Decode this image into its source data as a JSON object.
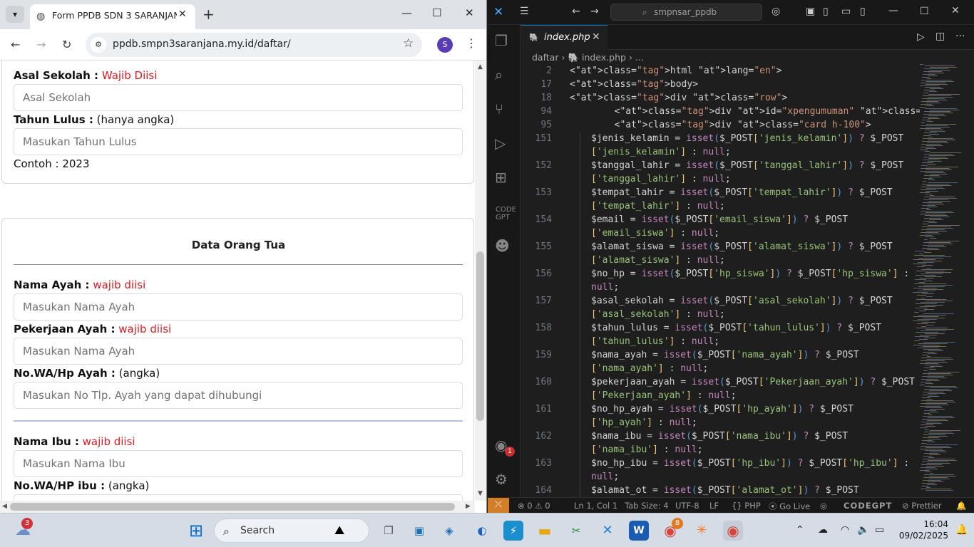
{
  "browser": {
    "tab_title": "Form PPDB SDN 3 SARANJANA",
    "url": "ppdb.smpn3saranjana.my.id/daftar/",
    "profile_initial": "S",
    "icons": {
      "back": "arrow-left",
      "forward": "arrow-right",
      "reload": "reload",
      "site": "tune",
      "star": "star",
      "menu": "kebab"
    }
  },
  "form": {
    "asal_sekolah": {
      "label": "Asal Sekolah :",
      "req": "Wajib Diisi",
      "placeholder": "Asal Sekolah"
    },
    "tahun_lulus": {
      "label": "Tahun Lulus :",
      "note": "(hanya angka)",
      "placeholder": "Masukan Tahun Lulus",
      "example": "Contoh : 2023"
    },
    "section_title": "Data Orang Tua",
    "nama_ayah": {
      "label": "Nama Ayah :",
      "req": "wajib diisi",
      "placeholder": "Masukan Nama Ayah"
    },
    "pekerjaan_ayah": {
      "label": "Pekerjaan Ayah :",
      "req": "wajib diisi",
      "placeholder": "Masukan Nama Ayah"
    },
    "hp_ayah": {
      "label": "No.WA/Hp Ayah :",
      "note": "(angka)",
      "placeholder": "Masukan No Tlp. Ayah yang dapat dihubungi"
    },
    "nama_ibu": {
      "label": "Nama Ibu :",
      "req": "wajib diisi",
      "placeholder": "Masukan Nama Ibu"
    },
    "hp_ibu": {
      "label": "No.WA/HP ibu :",
      "note": "(angka)"
    }
  },
  "vscode": {
    "search": "smpnsar_ppdb",
    "tab": "index.php",
    "breadcrumb": [
      "daftar",
      "index.php",
      "..."
    ],
    "line_numbers": [
      "2",
      "17",
      "18",
      "94",
      "95",
      "151",
      "152",
      "153",
      "154",
      "155",
      "156",
      "157",
      "158",
      "159",
      "160",
      "161",
      "162",
      "163",
      "164"
    ],
    "sticky": [
      "<html lang=\"en\">",
      "<body>",
      "<div class=\"row\">",
      "        <div id=\"xpengumuman\" class=\"col-lg-6 mb-5\">",
      "        <div class=\"card h-100\">"
    ],
    "lines": [
      [
        "$jenis_kelamin = isset($_POST['jenis_kelamin']) ? $_POST",
        "['jenis_kelamin'] : null;"
      ],
      [
        "$tanggal_lahir = isset($_POST['tanggal_lahir']) ? $_POST",
        "['tanggal_lahir'] : null;"
      ],
      [
        "$tempat_lahir = isset($_POST['tempat_lahir']) ? $_POST",
        "['tempat_lahir'] : null;"
      ],
      [
        "$email = isset($_POST['email_siswa']) ? $_POST",
        "['email_siswa'] : null;"
      ],
      [
        "$alamat_siswa = isset($_POST['alamat_siswa']) ? $_POST",
        "['alamat_siswa'] : null;"
      ],
      [
        "$no_hp = isset($_POST['hp_siswa']) ? $_POST['hp_siswa'] :",
        "null;"
      ],
      [
        "$asal_sekolah = isset($_POST['asal_sekolah']) ? $_POST",
        "['asal_sekolah'] : null;"
      ],
      [
        "$tahun_lulus = isset($_POST['tahun_lulus']) ? $_POST",
        "['tahun_lulus'] : null;"
      ],
      [
        "$nama_ayah = isset($_POST['nama_ayah']) ? $_POST",
        "['nama_ayah'] : null;"
      ],
      [
        "$pekerjaan_ayah = isset($_POST['Pekerjaan_ayah']) ? $_POST",
        "['Pekerjaan_ayah'] : null;"
      ],
      [
        "$no_hp_ayah = isset($_POST['hp_ayah']) ? $_POST",
        "['hp_ayah'] : null;"
      ],
      [
        "$nama_ibu = isset($_POST['nama_ibu']) ? $_POST",
        "['nama_ibu'] : null;"
      ],
      [
        "$no_hp_ibu = isset($_POST['hp_ibu']) ? $_POST['hp_ibu'] :",
        "null;"
      ],
      [
        "$alamat_ot = isset($_POST['alamat_ot']) ? $_POST",
        ""
      ]
    ],
    "status": {
      "problems": "⊗ 0 ⚠ 0",
      "position": "Ln 1, Col 1",
      "tab_size": "Tab Size: 4",
      "encoding": "UTF-8",
      "eol": "LF",
      "language": "{} PHP",
      "live": "Go Live",
      "codegpt": "CODEGPT",
      "prettier": "Prettier"
    },
    "accent": "#0078d4",
    "notification_count": "1"
  },
  "taskbar": {
    "search": "Search",
    "time": "16:04",
    "date": "09/02/2025",
    "weather_badge": "3",
    "chrome_badge": "8"
  }
}
